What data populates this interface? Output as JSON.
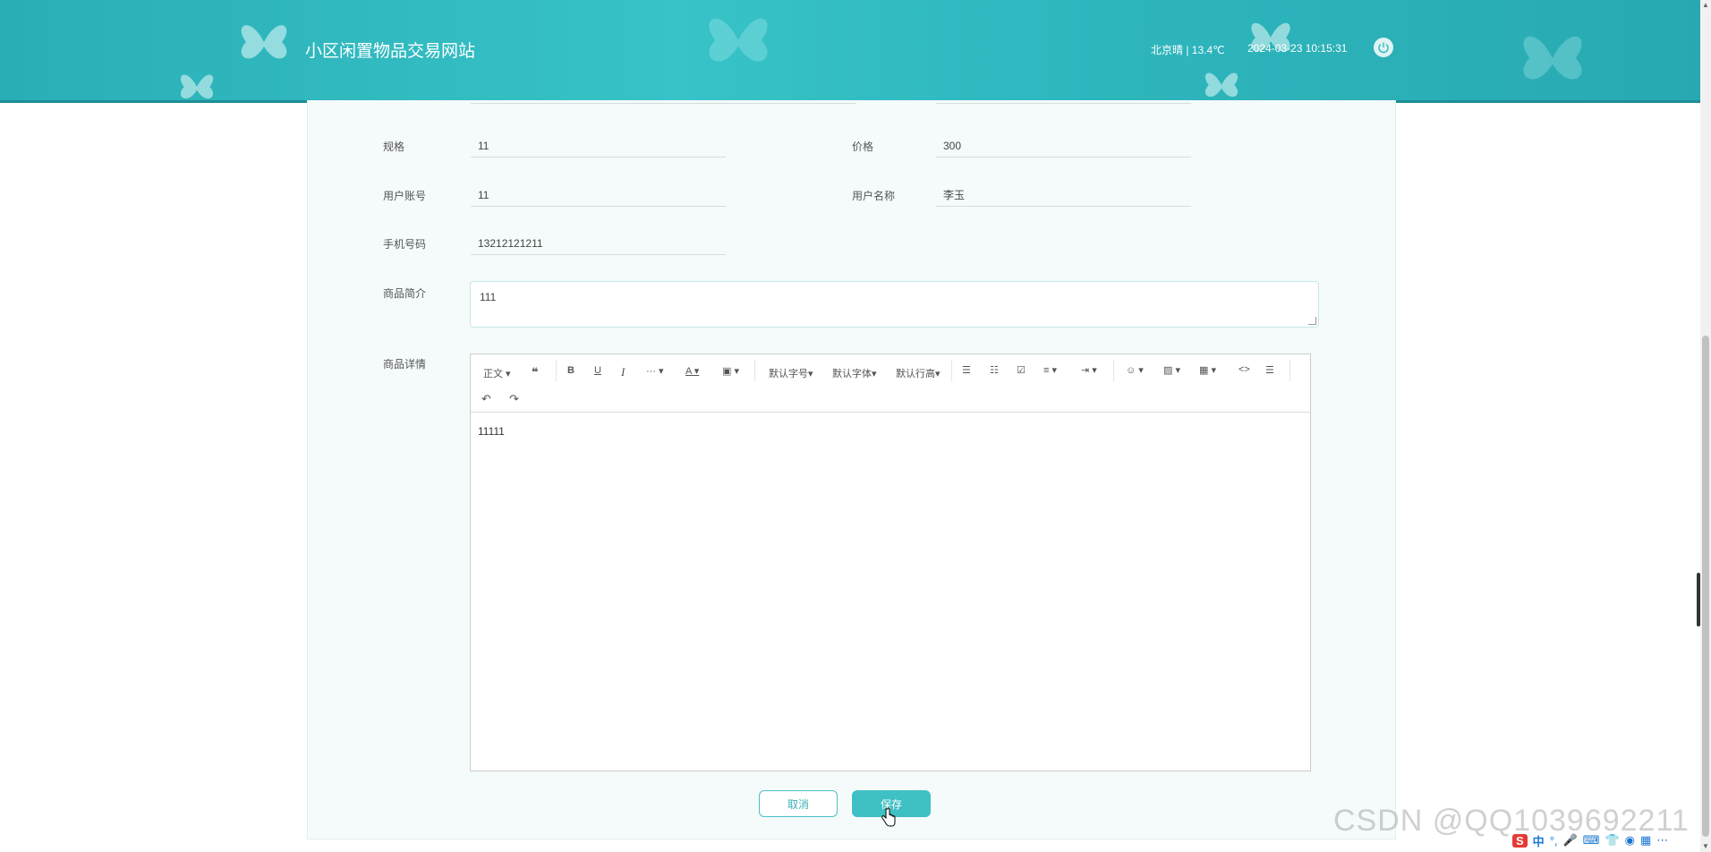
{
  "header": {
    "site_title": "小区闲置物品交易网站",
    "weather": "北京晴 | 13.4℃",
    "datetime": "2024-03-23 10:15:31",
    "bg_color": "#2fb8bf"
  },
  "form": {
    "spec_label": "规格",
    "spec_value": "11",
    "price_label": "价格",
    "price_value": "300",
    "account_label": "用户账号",
    "account_value": "11",
    "username_label": "用户名称",
    "username_value": "李玉",
    "phone_label": "手机号码",
    "phone_value": "13212121211",
    "intro_label": "商品简介",
    "intro_value": "111",
    "detail_label": "商品详情"
  },
  "editor": {
    "toolbar": {
      "paragraph": "正文",
      "font_size": "默认字号",
      "font_family": "默认字体",
      "line_height": "默认行高"
    },
    "content": "11111"
  },
  "buttons": {
    "cancel": "取消",
    "save": "保存"
  },
  "watermark": "CSDN @QQ1039692211",
  "tray": {
    "ime_logo": "S",
    "ime_mode": "中"
  },
  "colors": {
    "accent": "#3ec0c4",
    "header": "#2fb8bf"
  }
}
